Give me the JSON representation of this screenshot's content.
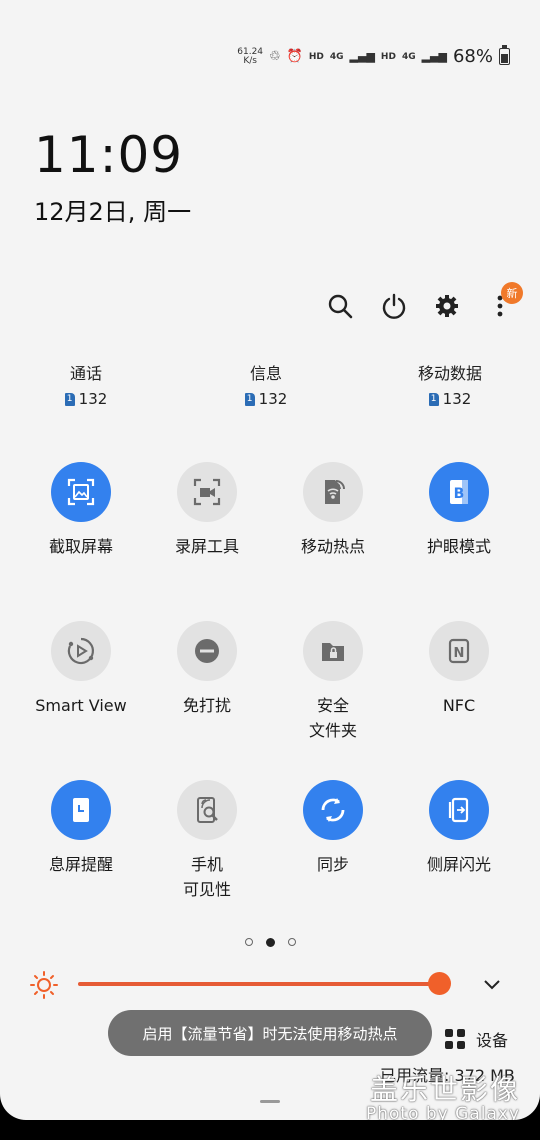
{
  "status_bar": {
    "net_speed_value": "61.24",
    "net_speed_unit": "K/s",
    "hd1": "HD",
    "net1": "4G",
    "hd2": "HD",
    "net2": "4G",
    "battery": "68%",
    "battery_level": 0.68
  },
  "clock": {
    "time": "11:09",
    "date": "12月2日, 周一"
  },
  "actions": {
    "new_badge": "新"
  },
  "sim_info": [
    {
      "label": "通话",
      "sim": "1",
      "value": "132"
    },
    {
      "label": "信息",
      "sim": "1",
      "value": "132"
    },
    {
      "label": "移动数据",
      "sim": "1",
      "value": "132"
    }
  ],
  "tiles": [
    {
      "label": "截取屏幕",
      "state": "on"
    },
    {
      "label": "录屏工具",
      "state": "off"
    },
    {
      "label": "移动热点",
      "state": "off"
    },
    {
      "label": "护眼模式",
      "state": "on",
      "icon_letter": "B"
    },
    {
      "label": "Smart View",
      "state": "off"
    },
    {
      "label": "免打扰",
      "state": "off"
    },
    {
      "label": "安全\n文件夹",
      "state": "off"
    },
    {
      "label": "NFC",
      "state": "off",
      "icon_letter": "N"
    },
    {
      "label": "息屏提醒",
      "state": "on"
    },
    {
      "label": "手机\n可见性",
      "state": "off"
    },
    {
      "label": "同步",
      "state": "on"
    },
    {
      "label": "侧屏闪光",
      "state": "on"
    }
  ],
  "pages": {
    "current": 2,
    "total": 3
  },
  "brightness": {
    "level": 0.97
  },
  "toast": "启用【流量节省】时无法使用移动热点",
  "devices_label": "设备",
  "data_used": "已用流量: 372 MB",
  "watermark": {
    "title": "盖乐世影像",
    "subtitle": "Photo by Galaxy"
  },
  "colors": {
    "accent": "#3381ee",
    "brightness": "#f0602a",
    "badge": "#f0792a"
  }
}
